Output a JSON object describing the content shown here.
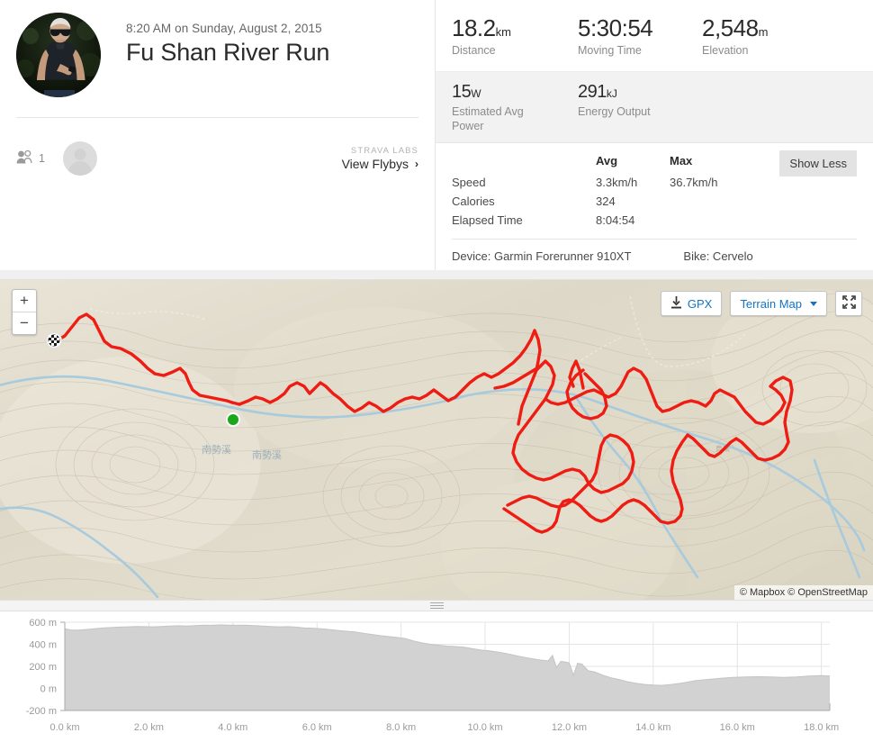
{
  "activity": {
    "date": "8:20 AM on Sunday, August 2, 2015",
    "title": "Fu Shan River Run",
    "avatar_name": "athlete-photo"
  },
  "social": {
    "kudos_count": "1",
    "kudos_icon": "people-icon",
    "labs_label": "STRAVA LABS",
    "flybys_label": "View Flybys",
    "chevron": "›"
  },
  "primary_stats": [
    {
      "value": "18.2",
      "unit": "km",
      "label": "Distance"
    },
    {
      "value": "5:30:54",
      "unit": "",
      "label": "Moving Time"
    },
    {
      "value": "2,548",
      "unit": "m",
      "label": "Elevation"
    }
  ],
  "secondary_stats": [
    {
      "value": "15",
      "unit": "W",
      "label": "Estimated Avg Power"
    },
    {
      "value": "291",
      "unit": "kJ",
      "label": "Energy Output"
    }
  ],
  "detail_table": {
    "headers": [
      "",
      "Avg",
      "Max"
    ],
    "rows": [
      {
        "name": "Speed",
        "avg": "3.3km/h",
        "max": "36.7km/h"
      },
      {
        "name": "Calories",
        "avg": "324",
        "max": ""
      },
      {
        "name": "Elapsed Time",
        "avg": "8:04:54",
        "max": ""
      }
    ],
    "show_less_label": "Show Less"
  },
  "device_info": {
    "device": "Device: Garmin Forerunner 910XT",
    "bike": "Bike: Cervelo"
  },
  "map": {
    "zoom_in": "+",
    "zoom_out": "−",
    "gpx_label": "GPX",
    "gpx_icon": "download-icon",
    "terrain_label": "Terrain Map",
    "fullscreen_icon": "expand-icon",
    "attribution": "© Mapbox © OpenStreetMap",
    "start_marker": "start-marker",
    "finish_marker": "finish-flag-marker",
    "route_color": "#ee1c12",
    "river_color": "#a8cadd",
    "terrain_color": "#e4dfd2",
    "river_labels": [
      "南勢溪",
      "南勢溪"
    ]
  },
  "chart_data": {
    "type": "area",
    "title": "",
    "xlabel": "",
    "ylabel": "",
    "xlim": [
      0,
      18.2
    ],
    "ylim": [
      -200,
      600
    ],
    "grid": true,
    "x_ticks": [
      "0.0 km",
      "2.0 km",
      "4.0 km",
      "6.0 km",
      "8.0 km",
      "10.0 km",
      "12.0 km",
      "14.0 km",
      "16.0 km",
      "18.0 km"
    ],
    "x_tick_values": [
      0,
      2,
      4,
      6,
      8,
      10,
      12,
      14,
      16,
      18
    ],
    "y_ticks": [
      "600 m",
      "400 m",
      "200 m",
      "0 m",
      "-200 m"
    ],
    "y_tick_values": [
      600,
      400,
      200,
      0,
      -200
    ],
    "series": [
      {
        "name": "Elevation",
        "color": "#d2d2d2",
        "x": [
          0.0,
          0.15,
          0.3,
          0.5,
          0.7,
          0.9,
          1.1,
          1.3,
          1.5,
          1.7,
          1.9,
          2.1,
          2.3,
          2.5,
          2.7,
          2.9,
          3.1,
          3.3,
          3.5,
          3.7,
          3.9,
          4.1,
          4.3,
          4.5,
          4.7,
          4.9,
          5.1,
          5.3,
          5.5,
          5.7,
          5.9,
          6.1,
          6.3,
          6.5,
          6.7,
          6.9,
          7.1,
          7.3,
          7.5,
          7.7,
          7.9,
          8.1,
          8.3,
          8.5,
          8.7,
          8.9,
          9.1,
          9.3,
          9.5,
          9.7,
          9.9,
          10.1,
          10.3,
          10.5,
          10.7,
          10.9,
          11.1,
          11.3,
          11.5,
          11.6,
          11.7,
          11.8,
          11.9,
          12.0,
          12.1,
          12.2,
          12.3,
          12.45,
          12.6,
          12.8,
          13.0,
          13.2,
          13.4,
          13.6,
          13.8,
          14.0,
          14.2,
          14.4,
          14.6,
          14.8,
          15.0,
          15.3,
          15.6,
          15.9,
          16.2,
          16.5,
          16.8,
          17.1,
          17.4,
          17.7,
          18.0,
          18.2
        ],
        "y": [
          540,
          530,
          528,
          534,
          540,
          548,
          552,
          556,
          558,
          562,
          560,
          558,
          562,
          566,
          568,
          566,
          570,
          574,
          572,
          576,
          574,
          572,
          574,
          570,
          566,
          562,
          558,
          560,
          556,
          548,
          546,
          540,
          534,
          526,
          518,
          512,
          500,
          490,
          478,
          470,
          462,
          452,
          430,
          412,
          400,
          392,
          384,
          380,
          374,
          360,
          348,
          340,
          330,
          316,
          300,
          284,
          270,
          258,
          250,
          300,
          190,
          246,
          240,
          232,
          120,
          228,
          220,
          160,
          150,
          120,
          96,
          80,
          60,
          46,
          36,
          30,
          28,
          34,
          44,
          56,
          70,
          82,
          92,
          100,
          104,
          106,
          104,
          100,
          104,
          112,
          116,
          112
        ]
      }
    ]
  }
}
